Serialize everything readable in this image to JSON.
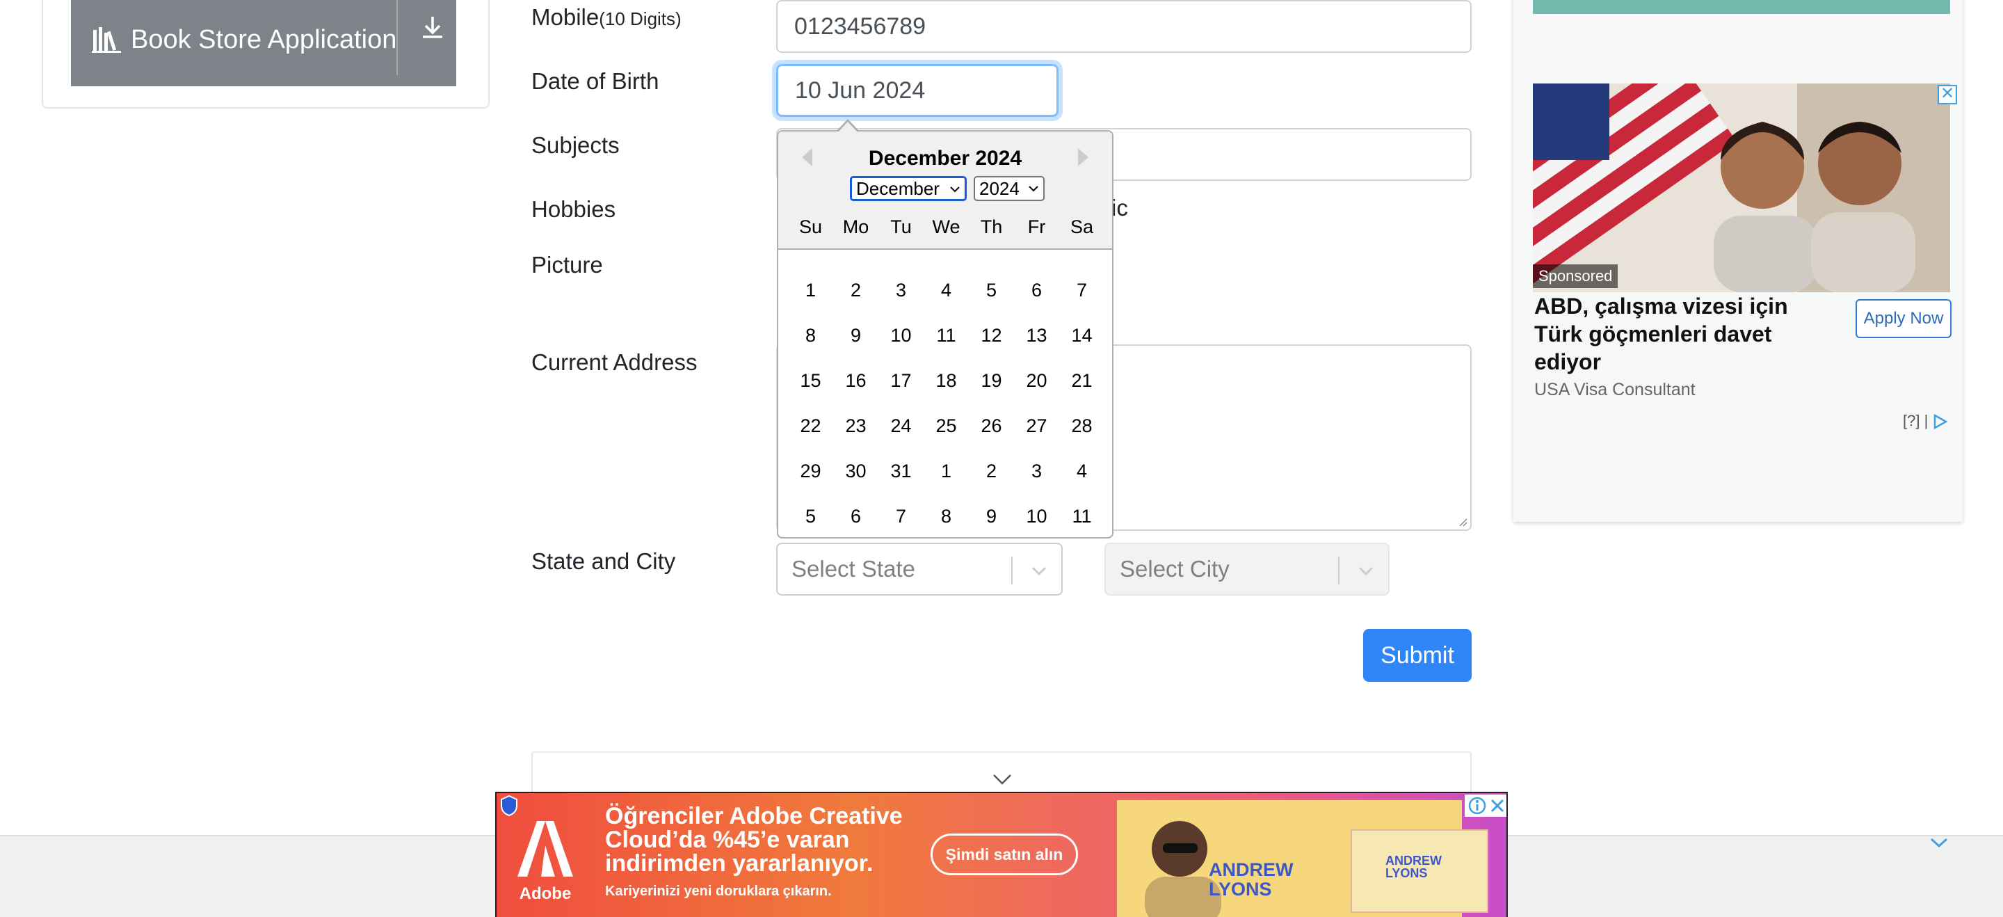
{
  "sidebar": {
    "store_button_label": "Book Store Application"
  },
  "form": {
    "mobile_label": "Mobile",
    "mobile_hint": "(10 Digits)",
    "mobile_value": "0123456789",
    "dob_label": "Date of Birth",
    "dob_value": "10 Jun 2024",
    "subjects_label": "Subjects",
    "hobbies_label": "Hobbies",
    "hobbies_partial_text": "ic",
    "picture_label": "Picture",
    "address_label": "Current Address",
    "state_city_label": "State and City",
    "state_placeholder": "Select State",
    "city_placeholder": "Select City",
    "submit_label": "Submit"
  },
  "datepicker": {
    "title": "December 2024",
    "month_select": "December",
    "year_select": "2024",
    "weekdays": [
      "Su",
      "Mo",
      "Tu",
      "We",
      "Th",
      "Fr",
      "Sa"
    ],
    "weeks": [
      [
        "1",
        "2",
        "3",
        "4",
        "5",
        "6",
        "7"
      ],
      [
        "8",
        "9",
        "10",
        "11",
        "12",
        "13",
        "14"
      ],
      [
        "15",
        "16",
        "17",
        "18",
        "19",
        "20",
        "21"
      ],
      [
        "22",
        "23",
        "24",
        "25",
        "26",
        "27",
        "28"
      ],
      [
        "29",
        "30",
        "31",
        "1",
        "2",
        "3",
        "4"
      ],
      [
        "5",
        "6",
        "7",
        "8",
        "9",
        "10",
        "11"
      ]
    ]
  },
  "ad_right": {
    "sponsored_label": "Sponsored",
    "close_glyph": "✕",
    "headline": "ABD, çalışma vizesi için Türk göçmenleri davet ediyor",
    "cta_label": "Apply Now",
    "source": "USA Visa Consultant",
    "info_label": "[?] |"
  },
  "ad_banner": {
    "brand": "Adobe",
    "headline_line1": "Öğrenciler Adobe Creative",
    "headline_line2": "Cloud’da %45’e varan",
    "headline_line3": "indirimden yararlanıyor.",
    "subline": "Kariyerinizi yeni doruklara çıkarın.",
    "cta_label": "Şimdi satın alın",
    "person_name_line1": "ANDREW",
    "person_name_line2": "LYONS",
    "card_name_line1": "ANDREW",
    "card_name_line2": "LYONS"
  },
  "colors": {
    "primary": "#2e86f8",
    "focus_ring": "#80bdff",
    "sidebar_button": "#7d8389",
    "ad_teal": "#74b8ad"
  }
}
